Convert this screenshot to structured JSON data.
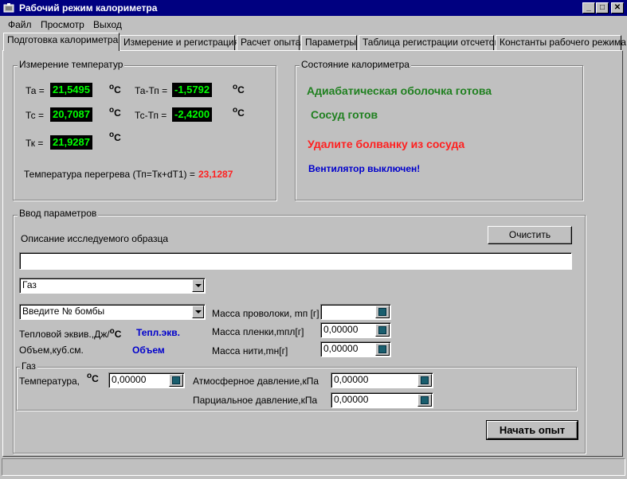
{
  "window": {
    "title": "Рабочий режим калориметра",
    "controls": {
      "minimize": "_",
      "maximize": "□",
      "close": "✕"
    }
  },
  "menu": [
    "Файл",
    "Просмотр",
    "Выход"
  ],
  "tabs": [
    "Подготовка калориметра",
    "Измерение и регистрация",
    "Расчет опыта",
    "Параметры",
    "Таблица регистрации отсчетов",
    "Константы рабочего режима"
  ],
  "temps": {
    "group_title": "Измерение температур",
    "ta_label": "Та =",
    "ta_value": "21,5495",
    "tc_label": "Тс =",
    "tc_value": "20,7087",
    "tk_label": "Тк =",
    "tk_value": "21,9287",
    "tatp_label": "Та-Тп =",
    "tatp_value": "-1,5792",
    "tctp_label": "Тс-Тп =",
    "tctp_value": "-2,4200",
    "unit_deg": "o",
    "unit_c": "C",
    "overheat_label": "Температура  перегрева (Тп=Тк+dT1)  =",
    "overheat_value": "23,1287",
    "overheat_color": "#ff2020"
  },
  "state": {
    "group_title": "Состояние калориметра",
    "line1": "Адиабатическая оболочка готова",
    "line2": "Сосуд готов",
    "line3": "Удалите болванку из сосуда",
    "line4": "Вентилятор выключен!",
    "green": "#208020",
    "red": "#ff2020",
    "blue": "#0000cc"
  },
  "params": {
    "group_title": "Ввод параметров",
    "description_label": "Описание исследуемого образца",
    "description_value": "",
    "clear_button": "Очистить",
    "substance_select": "Газ",
    "bomb_select": "Введите № бомбы",
    "heat_equiv_label": "Тепловой эквив.,Дж/",
    "heat_equiv_unit_deg": "o",
    "heat_equiv_unit_c": "C",
    "heat_equiv_value": "Тепл.экв.",
    "volume_label": "Объем,куб.см.",
    "volume_value": "Объем",
    "wire_mass_label": "Масса проволоки, mп [г]",
    "wire_mass_value": "",
    "film_mass_label": "Масса пленки,mпл[г]",
    "film_mass_value": "0,00000",
    "thread_mass_label": "Масса нити,mн[г]",
    "thread_mass_value": "0,00000",
    "gas": {
      "group_title": "Газ",
      "temp_label": "Температура,",
      "temp_unit_deg": "o",
      "temp_unit_c": "C",
      "temp_value": "0,00000",
      "atm_label": "Атмосферное давление,кПа",
      "atm_value": "0,00000",
      "partial_label": "Парциальное давление,кПа",
      "partial_value": "0,00000"
    },
    "start_button": "Начать опыт"
  },
  "statusbar": {
    "text": ""
  }
}
